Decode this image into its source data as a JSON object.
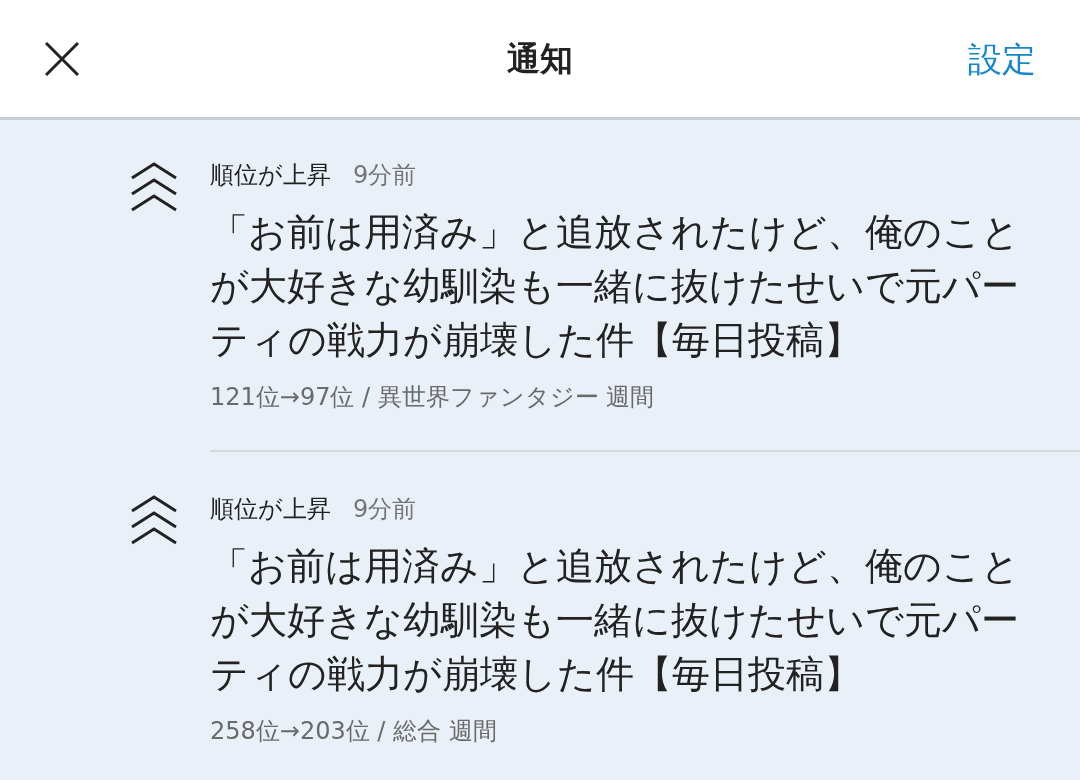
{
  "header": {
    "title": "通知",
    "action": "設定"
  },
  "notifications": [
    {
      "kind": "rank_up",
      "label": "順位が上昇",
      "time": "9分前",
      "title": "「お前は用済み」と追放されたけど、俺のことが大好きな幼馴染も一緒に抜けたせいで元パーティの戦力が崩壊した件【毎日投稿】",
      "detail": "121位→97位 / 異世界ファンタジー 週間"
    },
    {
      "kind": "rank_up",
      "label": "順位が上昇",
      "time": "9分前",
      "title": "「お前は用済み」と追放されたけど、俺のことが大好きな幼馴染も一緒に抜けたせいで元パーティの戦力が崩壊した件【毎日投稿】",
      "detail": "258位→203位 / 総合 週間"
    }
  ]
}
